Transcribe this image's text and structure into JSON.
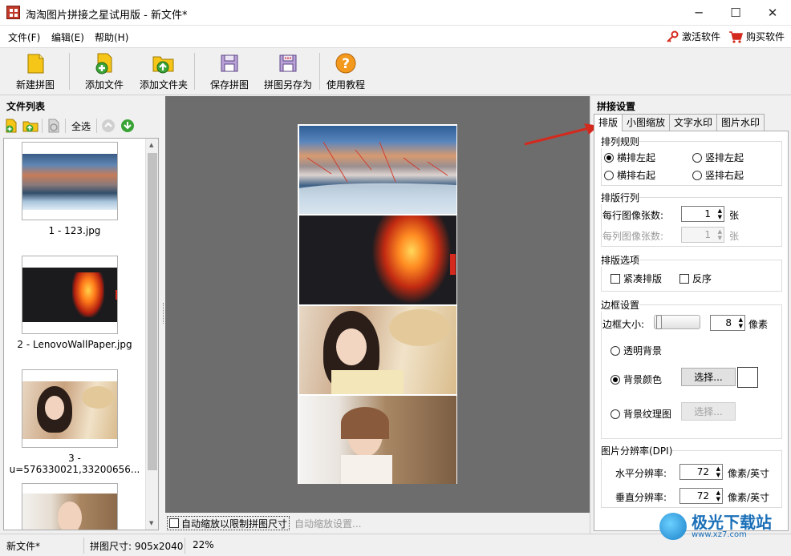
{
  "window": {
    "title": "淘淘图片拼接之星试用版 - 新文件*",
    "minimize": "─",
    "maximize": "☐",
    "close": "✕"
  },
  "menu": {
    "file": "文件(F)",
    "edit": "编辑(E)",
    "help": "帮助(H)",
    "activate": "激活软件",
    "buy": "购买软件"
  },
  "toolbar": {
    "new_collage": "新建拼图",
    "add_files": "添加文件",
    "add_folder": "添加文件夹",
    "save_collage": "保存拼图",
    "save_as": "拼图另存为",
    "tutorial": "使用教程"
  },
  "file_list": {
    "title": "文件列表",
    "select_all": "全选",
    "items": [
      {
        "caption": "1 - 123.jpg"
      },
      {
        "caption": "2 - LenovoWallPaper.jpg"
      },
      {
        "caption_line1": "3 -",
        "caption_line2": "u=576330021,33200656..."
      }
    ]
  },
  "center": {
    "auto_zoom_label": "自动缩放以限制拼图尺寸",
    "auto_zoom_settings": "自动缩放设置..."
  },
  "settings": {
    "title": "拼接设置",
    "tabs": [
      "排版",
      "小图缩放",
      "文字水印",
      "图片水印"
    ],
    "arrangement_rule": {
      "title": "排列规则",
      "h_left": "横排左起",
      "v_left": "竖排左起",
      "h_right": "横排右起",
      "v_right": "竖排右起"
    },
    "rows_cols": {
      "title": "排版行列",
      "per_row_label": "每行图像张数:",
      "per_row_value": "1",
      "per_col_label": "每列图像张数:",
      "per_col_value": "1",
      "unit": "张"
    },
    "layout_options": {
      "title": "排版选项",
      "compact": "紧凑排版",
      "reverse": "反序"
    },
    "border": {
      "title": "边框设置",
      "size_label": "边框大小:",
      "size_value": "8",
      "size_unit": "像素",
      "transparent": "透明背景",
      "bg_color": "背景颜色",
      "bg_texture": "背景纹理图",
      "choose": "选择...",
      "choose_disabled": "选择..."
    },
    "dpi": {
      "title": "图片分辨率(DPI)",
      "h_label": "水平分辨率:",
      "h_value": "72",
      "v_label": "垂直分辨率:",
      "v_value": "72",
      "unit": "像素/英寸"
    }
  },
  "status": {
    "file": "新文件*",
    "size": "拼图尺寸: 905x2040",
    "zoom": "22%"
  },
  "watermark": {
    "name": "极光下载站",
    "url": "www.xz7.com"
  },
  "colors": {
    "accent_red": "#d42a1e",
    "canvas_gray": "#6d6d6d",
    "watermark_blue": "#1a6fb8"
  }
}
